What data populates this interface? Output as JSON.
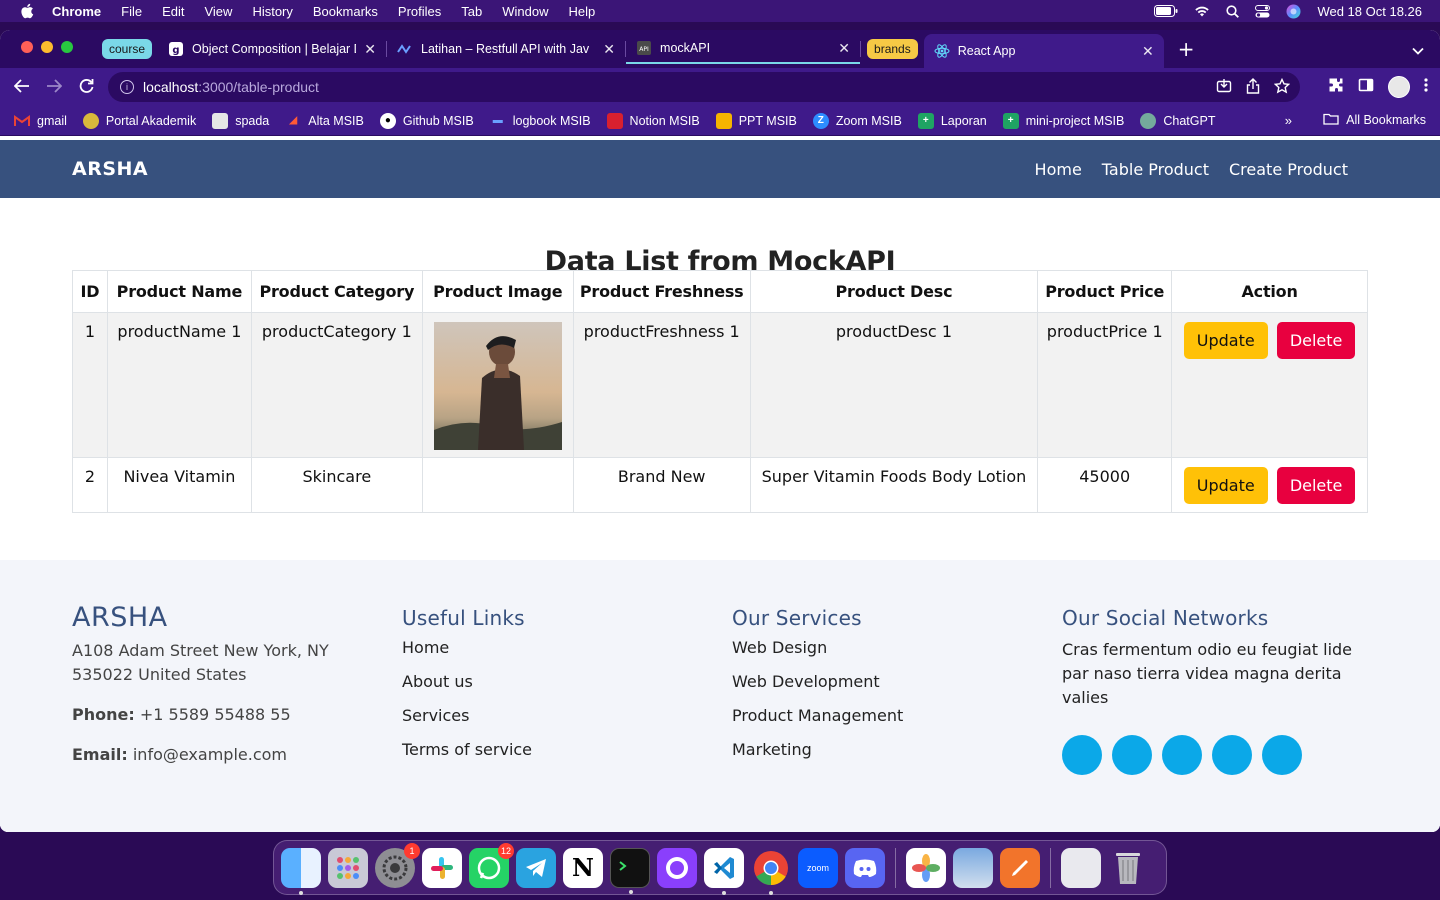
{
  "menubar": {
    "app": "Chrome",
    "items": [
      "File",
      "Edit",
      "View",
      "History",
      "Bookmarks",
      "Profiles",
      "Tab",
      "Window",
      "Help"
    ],
    "clock": "Wed 18 Oct  18.26"
  },
  "tabs": {
    "group1": "course",
    "group2": "brands",
    "items": [
      {
        "title": "Object Composition | Belajar D",
        "icon": "dicoding-icon"
      },
      {
        "title": "Latihan – Restfull API with Jav",
        "icon": "latihan-icon"
      },
      {
        "title": "mockAPI",
        "icon": "mockapi-icon"
      },
      {
        "title": "React App",
        "icon": "react-icon"
      }
    ]
  },
  "address": {
    "host": "localhost",
    "path": ":3000/table-product"
  },
  "bookmarks": {
    "items": [
      "gmail",
      "Portal Akademik",
      "spada",
      "Alta MSIB",
      "Github MSIB",
      "logbook MSIB",
      "Notion MSIB",
      "PPT MSIB",
      "Zoom MSIB",
      "Laporan",
      "mini-project MSIB",
      "ChatGPT"
    ],
    "more": "»",
    "all": "All Bookmarks"
  },
  "site": {
    "logo": "ARSHA",
    "nav": [
      "Home",
      "Table Product",
      "Create Product"
    ],
    "heading": "Data List from MockAPI"
  },
  "table": {
    "headers": [
      "ID",
      "Product Name",
      "Product Category",
      "Product Image",
      "Product Freshness",
      "Product Desc",
      "Product Price",
      "Action"
    ],
    "rows": [
      {
        "id": "1",
        "name": "productName 1",
        "category": "productCategory 1",
        "image": "person-photo",
        "freshness": "productFreshness 1",
        "desc": "productDesc 1",
        "price": "productPrice 1"
      },
      {
        "id": "2",
        "name": "Nivea Vitamin",
        "category": "Skincare",
        "image": "",
        "freshness": "Brand New",
        "desc": "Super Vitamin Foods Body Lotion",
        "price": "45000"
      }
    ],
    "update_label": "Update",
    "delete_label": "Delete"
  },
  "footer": {
    "brand": "ARSHA",
    "address": "A108 Adam Street New York, NY 535022 United States",
    "phone_label": "Phone:",
    "phone": "+1 5589 55488 55",
    "email_label": "Email:",
    "email": "info@example.com",
    "useful_title": "Useful Links",
    "useful_links": [
      "Home",
      "About us",
      "Services",
      "Terms of service"
    ],
    "services_title": "Our Services",
    "services": [
      "Web Design",
      "Web Development",
      "Product Management",
      "Marketing"
    ],
    "social_title": "Our Social Networks",
    "social_text": "Cras fermentum odio eu feugiat lide par naso tierra videa magna derita valies"
  },
  "dock": {
    "badges": {
      "settings": "1",
      "whatsapp": "12"
    },
    "zoom_label": "zoom"
  },
  "colors": {
    "header": "#37517e",
    "update": "#ffc107",
    "delete": "#e8003f",
    "social": "#0ba8e8"
  }
}
